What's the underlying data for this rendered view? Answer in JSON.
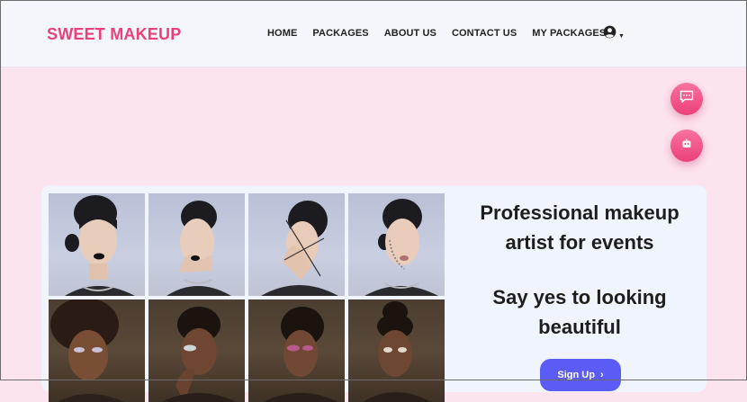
{
  "brand": {
    "name": "SWEET MAKEUP"
  },
  "nav": {
    "links": [
      "HOME",
      "PACKAGES",
      "ABOUT US",
      "CONTACT US",
      "MY PACKAGES"
    ],
    "account_icon": "user-circle-icon"
  },
  "floating_buttons": [
    {
      "name": "chat-icon"
    },
    {
      "name": "robot-icon"
    }
  ],
  "hero": {
    "headline": "Professional makeup artist for events",
    "tagline": "Say yes to looking beautiful",
    "cta_label": "Sign Up",
    "cta_icon": "chevron-right-icon",
    "gallery_count": 8
  },
  "colors": {
    "brand": "#ec407a",
    "page_background": "#fce4ef",
    "card_background": "#f0f4fc",
    "cta": "#5b5cf6"
  }
}
